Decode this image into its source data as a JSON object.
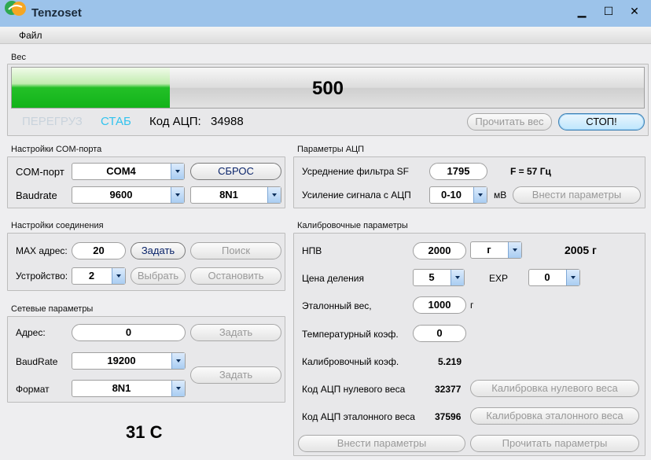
{
  "window": {
    "title": "Tenzoset",
    "minimize": "▁",
    "maximize": "☐",
    "close": "✕"
  },
  "menu": {
    "file": "Файл"
  },
  "weight": {
    "section": "Вес",
    "value": "500",
    "progress_fraction": 0.25,
    "overload": "ПЕРЕГРУЗ",
    "stable": "СТАБ",
    "adc_label": "Код АЦП:",
    "adc_value": "34988",
    "read_button": "Прочитать вес",
    "stop_button": "СТОП!"
  },
  "com": {
    "section": "Настройки COM-порта",
    "port_label": "COM-порт",
    "port_value": "COM4",
    "reset_button": "СБРОС",
    "baud_label": "Baudrate",
    "baud_value": "9600",
    "format_value": "8N1"
  },
  "connection": {
    "section": "Настройки соединения",
    "max_addr_label": "MAX адрес:",
    "max_addr_value": "20",
    "set_button": "Задать",
    "search_button": "Поиск",
    "device_label": "Устройство:",
    "device_value": "2",
    "select_button": "Выбрать",
    "stop_button": "Остановить"
  },
  "network": {
    "section": "Сетевые параметры",
    "addr_label": "Адрес:",
    "addr_value": "0",
    "addr_set_button": "Задать",
    "baud_label": "BaudRate",
    "baud_value": "19200",
    "format_label": "Формат",
    "format_value": "8N1",
    "set_button": "Задать"
  },
  "temperature": "31 C",
  "adc": {
    "section": "Параметры АЦП",
    "filter_label": "Усреднение фильтра SF",
    "filter_value": "1795",
    "freq_text": "F = 57 Гц",
    "gain_label": "Усиление сигнала с АЦП",
    "gain_value": "0-10",
    "gain_unit": "мВ",
    "apply_button": "Внести параметры"
  },
  "calibration": {
    "section": "Калибровочные параметры",
    "npv_label": "НПВ",
    "npv_value": "2000",
    "npv_unit": "г",
    "npv_display": "2005 г",
    "division_label": "Цена деления",
    "division_value": "5",
    "exp_label": "EXP",
    "exp_value": "0",
    "ref_weight_label": "Эталонный вес,",
    "ref_weight_value": "1000",
    "ref_weight_unit": "г",
    "temp_coef_label": "Температурный коэф.",
    "temp_coef_value": "0",
    "calib_coef_label": "Калибровочный коэф.",
    "calib_coef_value": "5.219",
    "zero_adc_label": "Код АЦП нулевого веса",
    "zero_adc_value": "32377",
    "zero_calib_button": "Калибровка нулевого веса",
    "ref_adc_label": "Код АЦП эталонного веса",
    "ref_adc_value": "37596",
    "ref_calib_button": "Калибровка эталонного веса",
    "apply_button": "Внести параметры",
    "read_button": "Прочитать параметры"
  }
}
